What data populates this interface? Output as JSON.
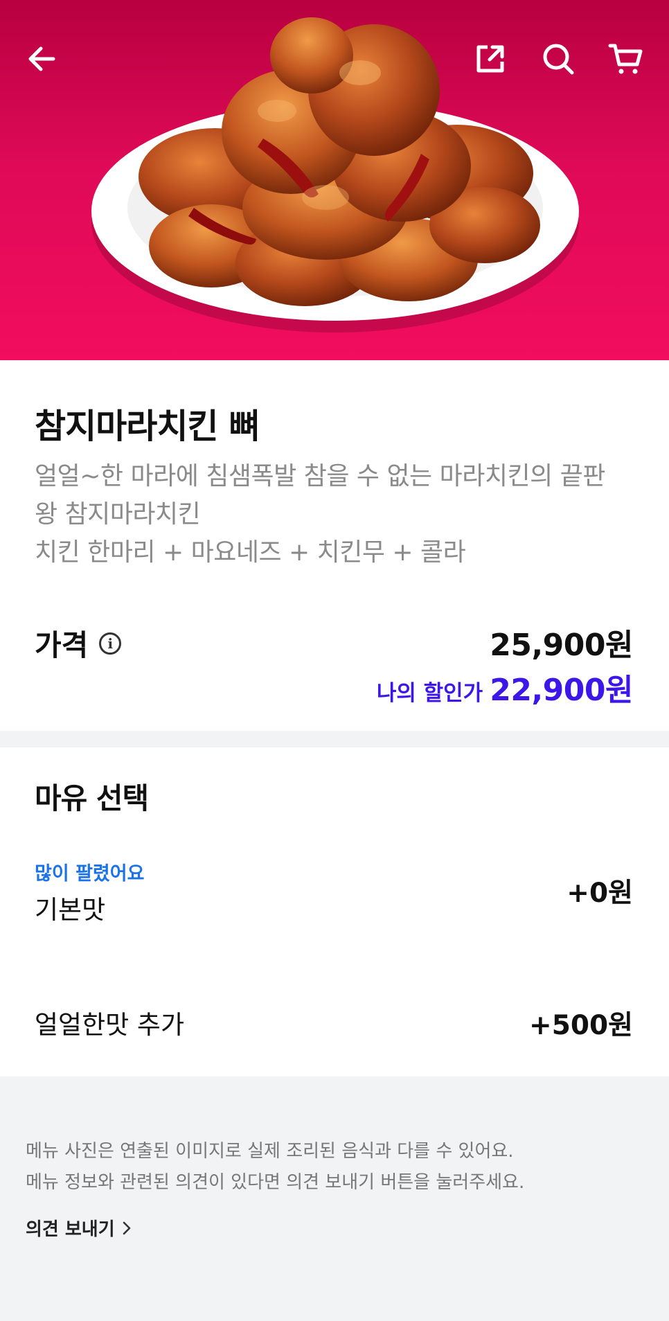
{
  "header": {
    "back_icon": "arrow-left-icon",
    "share_icon": "share-icon",
    "search_icon": "search-icon",
    "cart_icon": "cart-icon",
    "hero_background": "#e60a58"
  },
  "product": {
    "title": "참지마라치킨 뼈",
    "description": [
      "얼얼~한 마라에 침샘폭발 참을 수 없는 마라치킨의 끝판",
      "왕 참지마라치킨",
      "치킨 한마리 + 마요네즈 + 치킨무 + 콜라"
    ],
    "price_label": "가격",
    "info_icon": "info-icon",
    "price": "25,900원",
    "discount_label": "나의 할인가",
    "discount_price": "22,900원",
    "accent_color": "#3d17e8"
  },
  "options": {
    "title": "마유 선택",
    "items": [
      {
        "badge": "많이 팔렸어요",
        "name": "기본맛",
        "price": "+0원"
      },
      {
        "badge": "",
        "name": "얼얼한맛 추가",
        "price": "+500원"
      }
    ]
  },
  "footer": {
    "notice": [
      "메뉴 사진은 연출된 이미지로 실제 조리된 음식과 다를 수 있어요.",
      "메뉴 정보와 관련된 의견이 있다면 의견 보내기 버튼을 눌러주세요."
    ],
    "feedback_label": "의견 보내기"
  }
}
